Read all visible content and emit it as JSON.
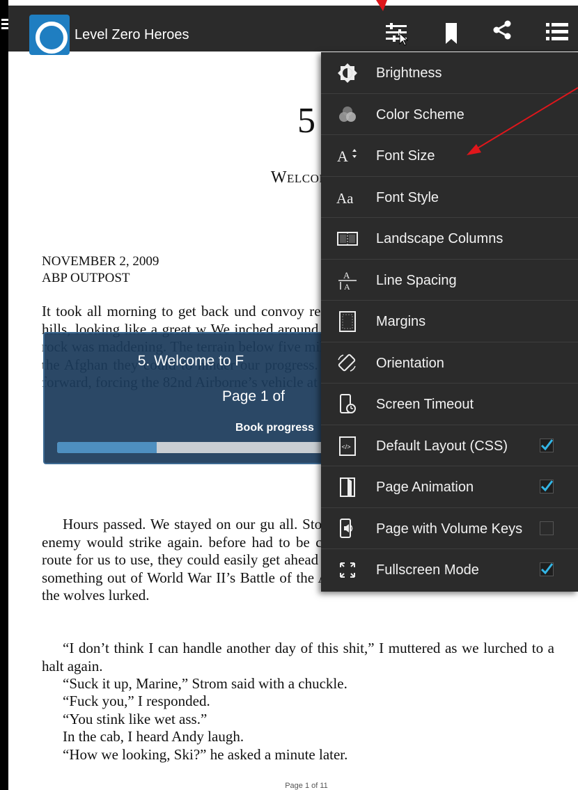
{
  "header": {
    "book_title": "Level Zero Heroes",
    "icons": [
      "menu-icon",
      "app-logo",
      "settings-sliders-icon",
      "bookmark-icon",
      "share-icon",
      "list-icon"
    ]
  },
  "chapter": {
    "number": "5",
    "title": "Welcome to F"
  },
  "dateline": {
    "date": "NOVEMBER 2, 2009",
    "location": "ABP OUTPOST"
  },
  "body_text": {
    "p1": "It took all morning to get back und convoy reassembled and stretched out mammoth hills, looking like a great w We inched around breaks straight from the marrow of the rock was maddening. The terrain below five miles an hour through became evident that the Afghan they could to hinder our progress. the road; at every major slope they co forward, forcing the 82nd Airborne’s vehicle at a time.",
    "p2": "Hours passed. We stayed on our gu all. Stop. Go. Stop. Go. We crawled when the enemy would strike again. before had to be close. Given our spe only one possible route for us to use, they could easily get ahead of us to lay another ambush. It felt like something out of World War II’s Battle of the Atlantic. Beyond our little convoy lane, the wolves lurked.",
    "p3": "“I don’t think I can handle another day of this shit,” I muttered as we lurched to a halt again.",
    "p4": "“Suck it up, Marine,” Strom said with a chuckle.",
    "p5": "“Fuck you,” I responded.",
    "p6": "“You stink like wet ass.”",
    "p7": "In the cab, I heard Andy laugh.",
    "p8": "“How we looking, Ski?” he asked a minute later."
  },
  "footer": {
    "page_indicator": "Page 1 of 11"
  },
  "progress_popup": {
    "chapter_label": "5. Welcome to F",
    "page_label": "Page 1 of",
    "progress_label": "Book progress",
    "book_progress_fraction": 0.34
  },
  "menu": {
    "items": [
      {
        "label": "Brightness",
        "icon": "brightness-icon"
      },
      {
        "label": "Color Scheme",
        "icon": "color-scheme-icon"
      },
      {
        "label": "Font Size",
        "icon": "font-size-icon"
      },
      {
        "label": "Font Style",
        "icon": "font-style-icon"
      },
      {
        "label": "Landscape Columns",
        "icon": "landscape-columns-icon"
      },
      {
        "label": "Line Spacing",
        "icon": "line-spacing-icon"
      },
      {
        "label": "Margins",
        "icon": "margins-icon"
      },
      {
        "label": "Orientation",
        "icon": "orientation-icon"
      },
      {
        "label": "Screen Timeout",
        "icon": "screen-timeout-icon"
      },
      {
        "label": "Default Layout (CSS)",
        "icon": "code-icon",
        "checked": true
      },
      {
        "label": "Page Animation",
        "icon": "page-animation-icon",
        "checked": true
      },
      {
        "label": "Page with Volume Keys",
        "icon": "volume-keys-icon",
        "checked": false
      },
      {
        "label": "Fullscreen Mode",
        "icon": "fullscreen-icon",
        "checked": true
      }
    ]
  },
  "colors": {
    "action_bar": "#2b2b2b",
    "menu_background": "#2b2b2b",
    "checkbox_check": "#33b5e5",
    "popup_background": "#1b3a5a",
    "progress_fill": "#4e8fc0",
    "annotation_arrow": "#e0161b"
  }
}
